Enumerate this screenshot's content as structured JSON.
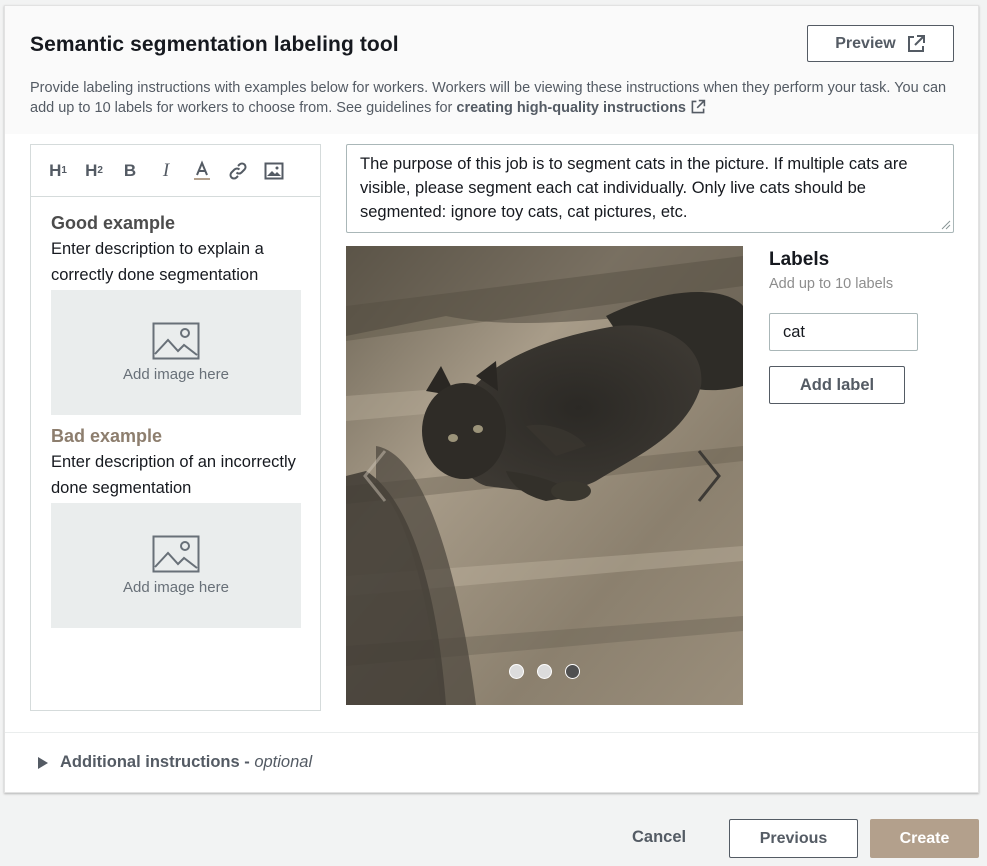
{
  "header": {
    "title": "Semantic segmentation labeling tool",
    "description": "Provide labeling instructions with examples below for workers. Workers will be viewing these instructions when they perform your task. You can add up to 10 labels for workers to choose from. See guidelines for ",
    "link_text": "creating high-quality instructions",
    "preview_label": "Preview"
  },
  "editor": {
    "toolbar": [
      {
        "name": "h1-button",
        "label": "H",
        "sub": "1"
      },
      {
        "name": "h2-button",
        "label": "H",
        "sub": "2"
      },
      {
        "name": "bold-button",
        "label": "B"
      },
      {
        "name": "italic-button",
        "label": "I"
      },
      {
        "name": "font-color-button",
        "icon": "font-color-icon"
      },
      {
        "name": "link-button",
        "icon": "link-icon"
      },
      {
        "name": "insert-image-button",
        "icon": "image-icon"
      }
    ],
    "good_heading": "Good example",
    "good_desc": "Enter description to explain a correctly done segmentation",
    "add_image_label": "Add image here",
    "bad_heading": "Bad example",
    "bad_desc": "Enter description of an incorrectly done segmentation"
  },
  "instructions": {
    "text": "The purpose of this job is to segment cats in the picture. If multiple cats are visible, please segment each cat individually. Only live cats should be segmented: ignore toy cats, cat pictures, etc."
  },
  "carousel": {
    "slide_count": 3,
    "active_slide": 3
  },
  "labels": {
    "title": "Labels",
    "subtitle": "Add up to 10 labels",
    "input_value": "cat",
    "add_button": "Add label"
  },
  "additional": {
    "label": "Additional instructions - ",
    "optional": "optional"
  },
  "footer": {
    "cancel": "Cancel",
    "previous": "Previous",
    "create": "Create"
  },
  "colors": {
    "primary_disabled": "#b3a08c",
    "text_secondary": "#545b64",
    "bad_heading": "#8d7e6e"
  }
}
